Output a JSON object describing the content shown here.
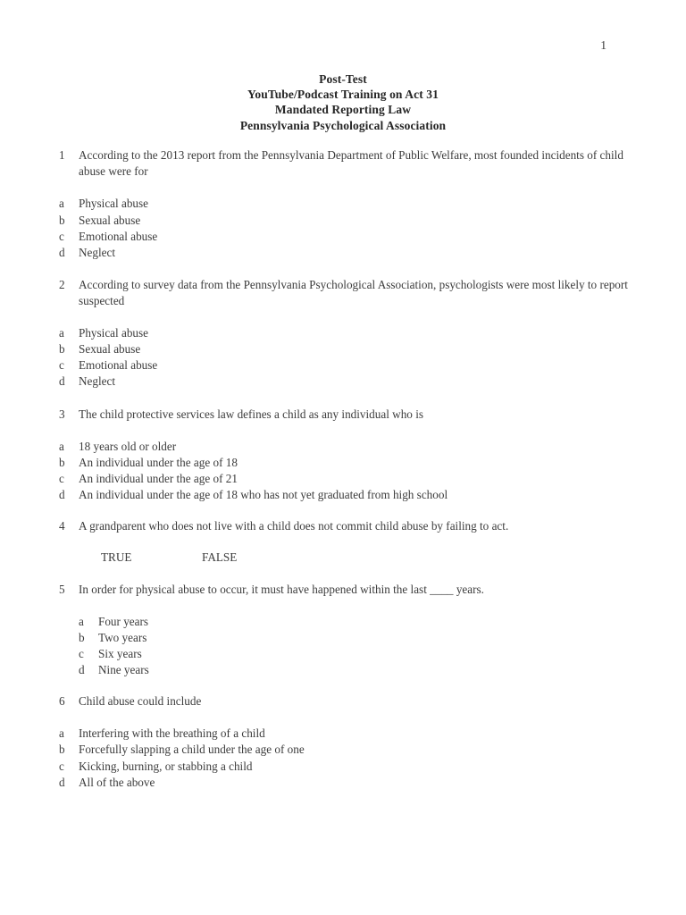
{
  "page": {
    "number": "1"
  },
  "title": {
    "lines": [
      "Post-Test",
      "YouTube/Podcast Training on Act 31",
      "Mandated Reporting Law",
      "Pennsylvania Psychological Association"
    ]
  },
  "true_false": {
    "true_label": "TRUE",
    "false_label": "FALSE"
  },
  "questions": [
    {
      "number": "1",
      "text": "According to the 2013 report from the Pennsylvania Department of Public Welfare, most founded incidents of child abuse were for",
      "options": [
        {
          "letter": "a",
          "text": "Physical abuse"
        },
        {
          "letter": "b",
          "text": "Sexual abuse"
        },
        {
          "letter": "c",
          "text": "Emotional abuse"
        },
        {
          "letter": "d",
          "text": "Neglect"
        }
      ]
    },
    {
      "number": "2",
      "text": "According to survey data from the Pennsylvania Psychological Association, psychologists were most likely to report suspected",
      "options": [
        {
          "letter": "a",
          "text": "Physical abuse"
        },
        {
          "letter": "b",
          "text": "Sexual abuse"
        },
        {
          "letter": "c",
          "text": "Emotional abuse"
        },
        {
          "letter": "d",
          "text": "Neglect"
        }
      ]
    },
    {
      "number": "3",
      "text": "The child protective services law defines a child as any individual who is",
      "options": [
        {
          "letter": "a",
          "text": "18 years old or older"
        },
        {
          "letter": "b",
          "text": "An individual under the age of 18"
        },
        {
          "letter": "c",
          "text": "An individual under the age of 21"
        },
        {
          "letter": "d",
          "text": "An individual under the age of 18 who has not yet graduated from high school"
        }
      ]
    },
    {
      "number": "4",
      "text": "A grandparent who does not live with a child does not commit child abuse by failing to act.",
      "options": []
    },
    {
      "number": "5",
      "text": "In order for physical abuse to occur, it must have happened within the last ____ years.",
      "options": [
        {
          "letter": "a",
          "text": "Four years"
        },
        {
          "letter": "b",
          "text": "Two years"
        },
        {
          "letter": "c",
          "text": "Six years"
        },
        {
          "letter": "d",
          "text": "Nine years"
        }
      ]
    },
    {
      "number": "6",
      "text": "Child abuse could include",
      "options": [
        {
          "letter": "a",
          "text": "Interfering with the breathing of a child"
        },
        {
          "letter": "b",
          "text": "Forcefully slapping a child under the age of one"
        },
        {
          "letter": "c",
          "text": "Kicking, burning, or stabbing a child"
        },
        {
          "letter": "d",
          "text": "All of the above"
        }
      ]
    }
  ]
}
